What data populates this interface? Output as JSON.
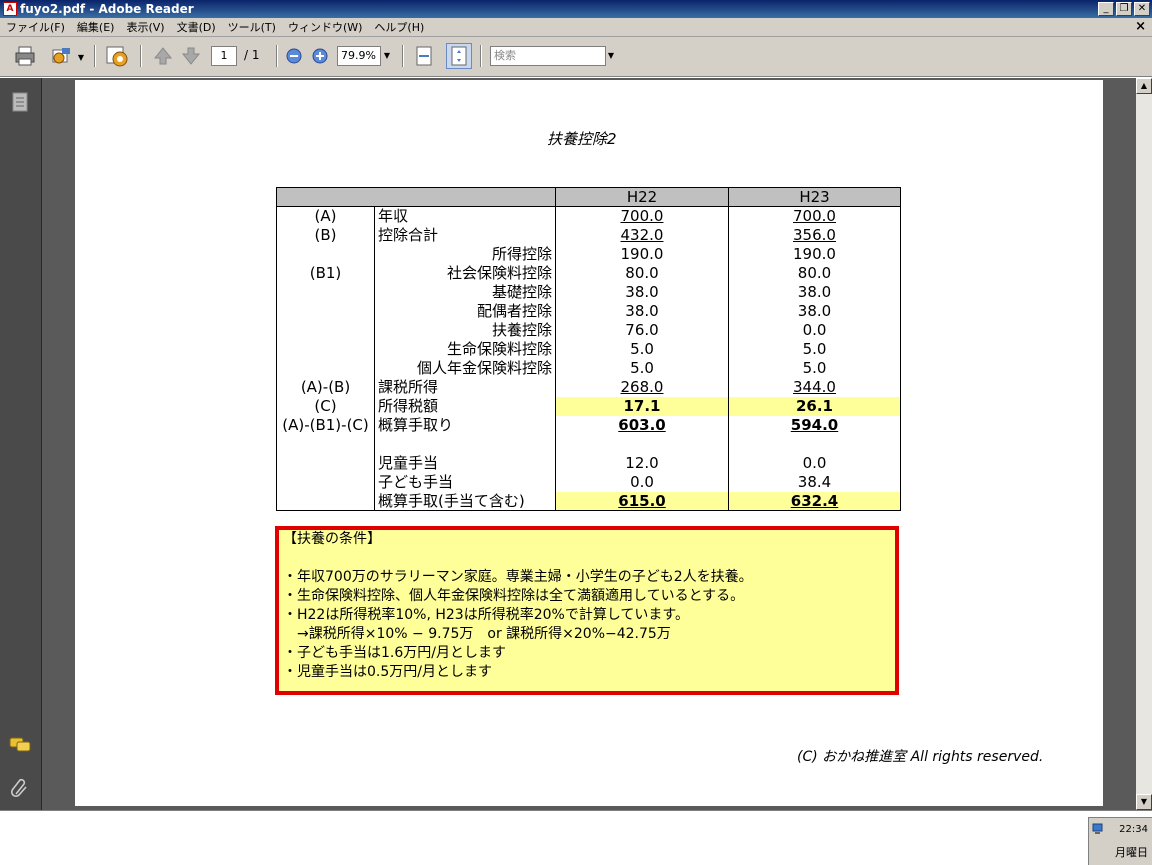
{
  "window": {
    "title": "fuyo2.pdf - Adobe Reader",
    "minimize": "_",
    "restore": "❐",
    "close": "✕"
  },
  "menubar": {
    "items": [
      "ファイル(F)",
      "編集(E)",
      "表示(V)",
      "文書(D)",
      "ツール(T)",
      "ウィンドウ(W)",
      "ヘルプ(H)"
    ],
    "doc_close": "×"
  },
  "toolbar": {
    "page_current": "1",
    "page_total": "/ 1",
    "zoom": "79.9%",
    "search_placeholder": "検索"
  },
  "document": {
    "title": "扶養控除2",
    "table": {
      "headers": [
        "",
        "H22",
        "H23"
      ],
      "rows": [
        {
          "code": "(A)",
          "label": "年収",
          "h22": "700.0",
          "h23": "700.0"
        },
        {
          "code": "(B)",
          "label": "控除合計",
          "h22": "432.0",
          "h23": "356.0"
        },
        {
          "code": "",
          "label": "所得控除",
          "h22": "190.0",
          "h23": "190.0"
        },
        {
          "code": "(B1)",
          "label": "社会保険料控除",
          "h22": "80.0",
          "h23": "80.0"
        },
        {
          "code": "",
          "label": "基礎控除",
          "h22": "38.0",
          "h23": "38.0"
        },
        {
          "code": "",
          "label": "配偶者控除",
          "h22": "38.0",
          "h23": "38.0"
        },
        {
          "code": "",
          "label": "扶養控除",
          "h22": "76.0",
          "h23": "0.0"
        },
        {
          "code": "",
          "label": "生命保険料控除",
          "h22": "5.0",
          "h23": "5.0"
        },
        {
          "code": "",
          "label": "個人年金保険料控除",
          "h22": "5.0",
          "h23": "5.0"
        },
        {
          "code": "(A)-(B)",
          "label": "課税所得",
          "h22": "268.0",
          "h23": "344.0"
        },
        {
          "code": "(C)",
          "label": "所得税額",
          "h22": "17.1",
          "h23": "26.1"
        },
        {
          "code": "(A)-(B1)-(C)",
          "label": "概算手取り",
          "h22": "603.0",
          "h23": "594.0"
        },
        {
          "code": "",
          "label": "",
          "h22": "",
          "h23": ""
        },
        {
          "code": "",
          "label": "児童手当",
          "h22": "12.0",
          "h23": "0.0"
        },
        {
          "code": "",
          "label": "子ども手当",
          "h22": "0.0",
          "h23": "38.4"
        },
        {
          "code": "",
          "label": "概算手取(手当て含む)",
          "h22": "615.0",
          "h23": "632.4"
        }
      ]
    },
    "conditions": {
      "heading": "【扶養の条件】",
      "lines": [
        "・年収700万のサラリーマン家庭。専業主婦・小学生の子ども2人を扶養。",
        "・生命保険料控除、個人年金保険料控除は全て満額適用しているとする。",
        "・H22は所得税率10%, H23は所得税率20%で計算しています。",
        "　→課税所得×10% − 9.75万　or 課税所得×20%−42.75万",
        "・子ども手当は1.6万円/月とします",
        "・児童手当は0.5万円/月とします"
      ]
    },
    "copyright": "(C) おかね推進室 All rights reserved."
  },
  "tray": {
    "time": "22:34",
    "day": "月曜日"
  },
  "colors": {
    "highlight": "#ffff99",
    "border_red": "#e00000",
    "header_gray": "#c0c0c0"
  }
}
